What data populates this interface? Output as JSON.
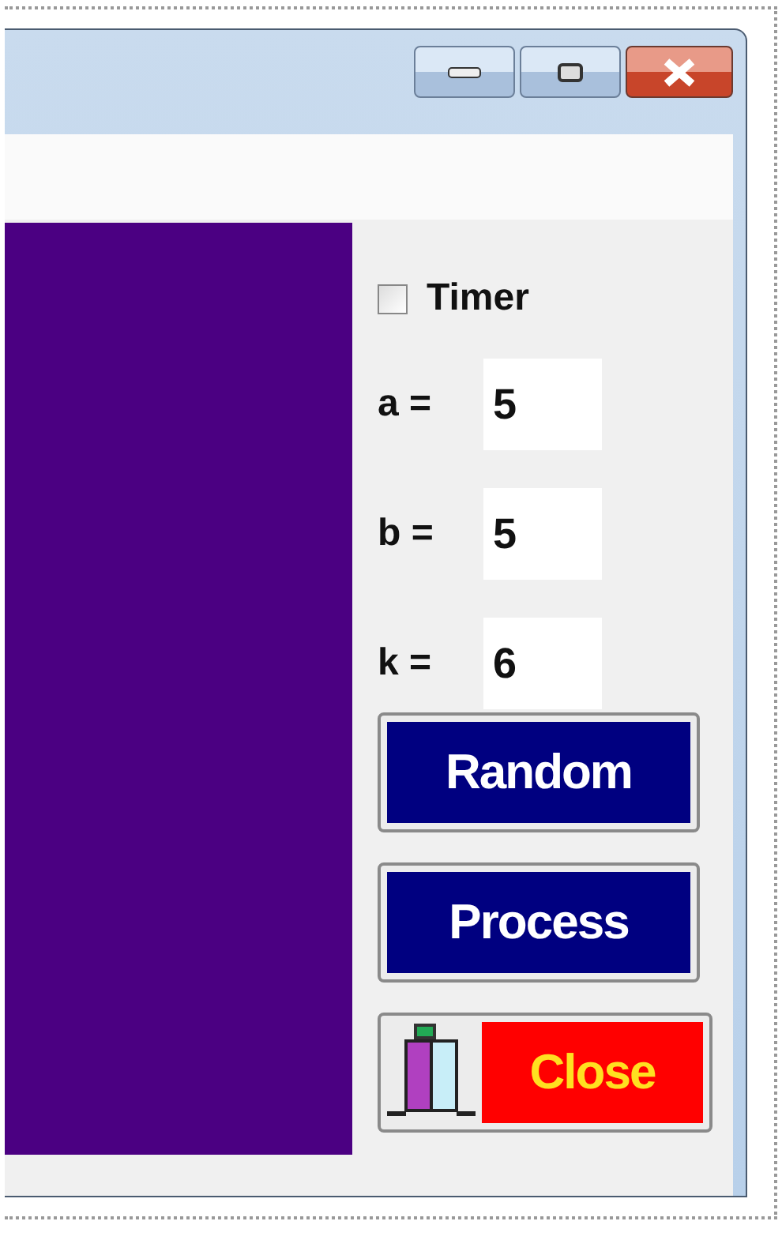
{
  "timer": {
    "label": "Timer",
    "checked": false
  },
  "params": [
    {
      "label": "a =",
      "value": "5"
    },
    {
      "label": "b =",
      "value": "5"
    },
    {
      "label": "k =",
      "value": "6"
    }
  ],
  "buttons": [
    {
      "label": "Random",
      "kind": "plain"
    },
    {
      "label": "Process",
      "kind": "plain"
    },
    {
      "label": "Close",
      "kind": "exit"
    }
  ]
}
